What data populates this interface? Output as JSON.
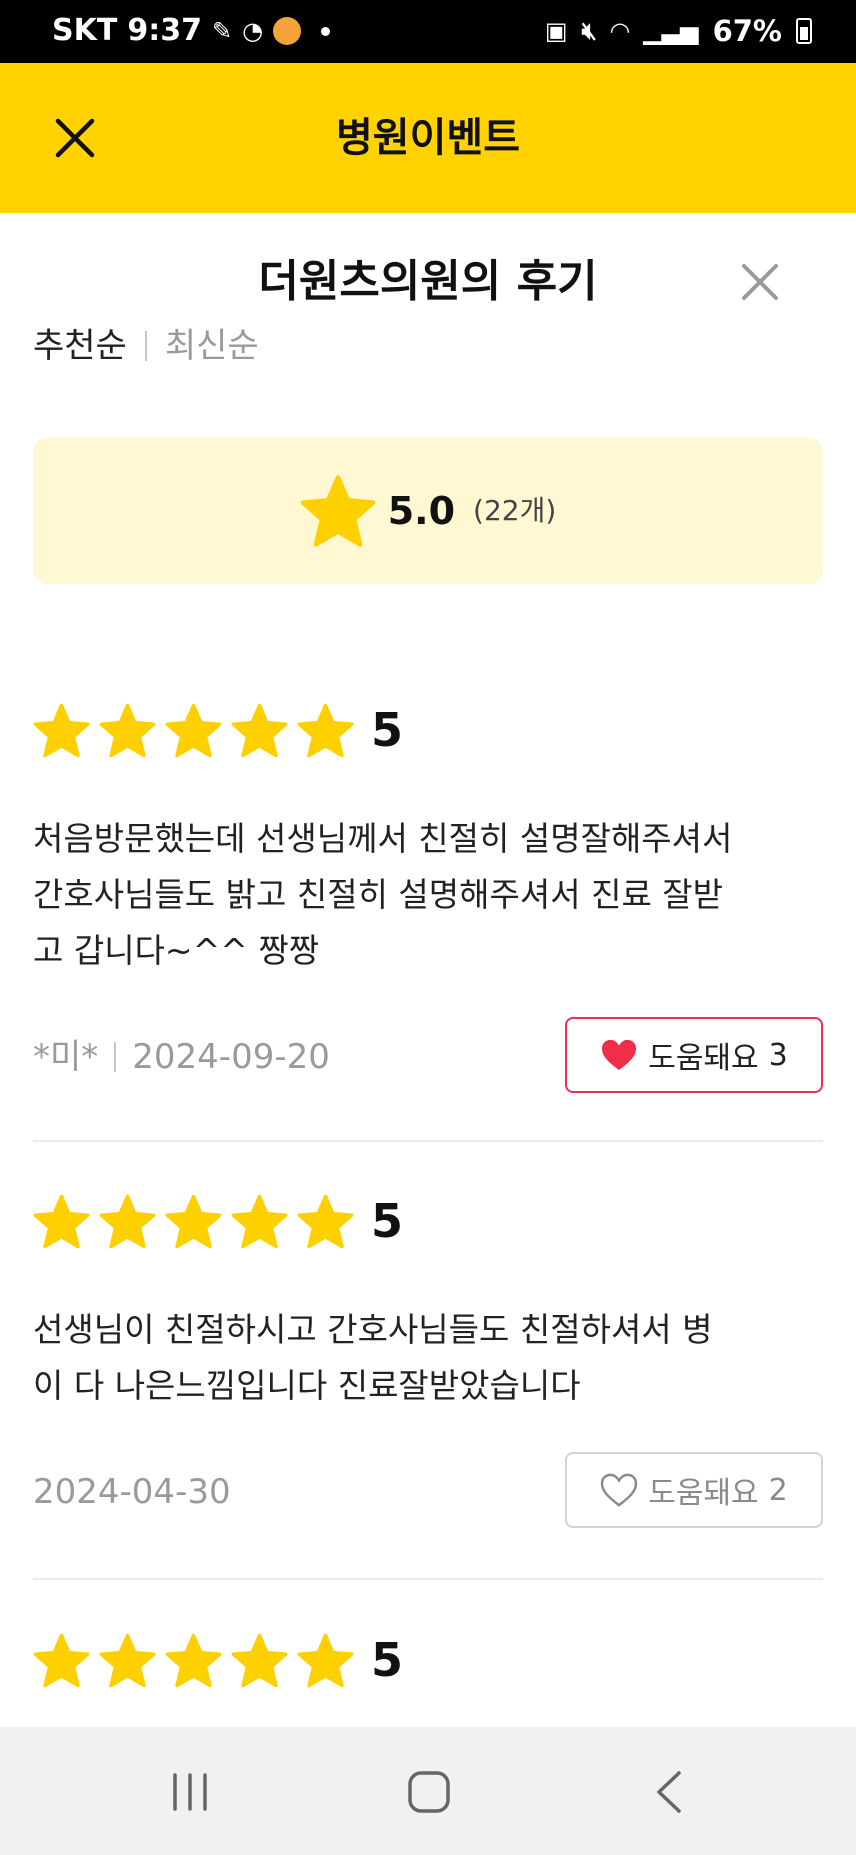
{
  "status_bar": {
    "carrier": "SKT",
    "time": "9:37",
    "battery": "67%"
  },
  "header": {
    "title": "병원이벤트"
  },
  "reviews_panel": {
    "title": "더원츠의원의 후기",
    "sort_options": [
      "추천순",
      "최신순"
    ],
    "summary": {
      "score": "5.0",
      "count": "(22개)"
    }
  },
  "reviews": [
    {
      "rating": 5,
      "rating_label": "5",
      "text_lines": [
        "처음방문했는데 선생님께서 친절히 설명잘해주셔서",
        "간호사님들도 밝고 친절히 설명해주셔서 진료 잘받",
        "고 갑니다~^^ 짱짱"
      ],
      "author": "*미*",
      "date": "2024-09-20",
      "helpful_label": "도움돼요",
      "helpful_count": "3",
      "helpful_active": true
    },
    {
      "rating": 5,
      "rating_label": "5",
      "text_lines": [
        "선생님이 친절하시고 간호사님들도 친절하셔서 병",
        "이 다 나은느낌입니다 진료잘받았습니다"
      ],
      "author": "",
      "date": "2024-04-30",
      "helpful_label": "도움돼요",
      "helpful_count": "2",
      "helpful_active": false
    },
    {
      "rating": 5,
      "rating_label": "5"
    }
  ],
  "colors": {
    "brand_yellow": "#ffd200",
    "star_yellow": "#ffd000",
    "summary_bg": "#fff8d2",
    "heart_red": "#e8344e"
  }
}
